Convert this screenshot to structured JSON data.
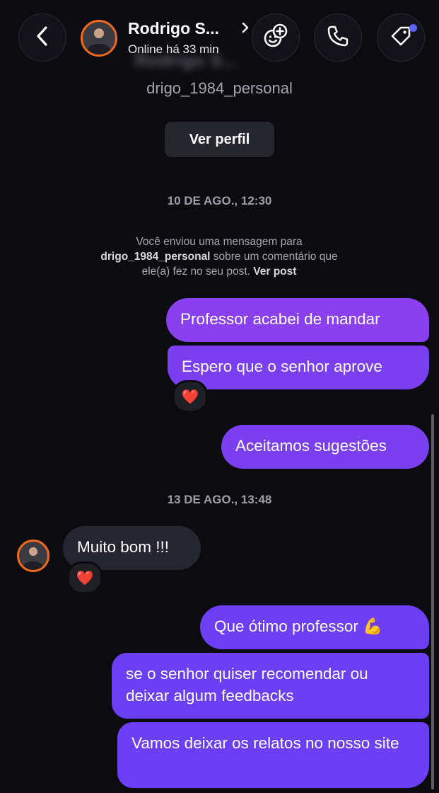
{
  "header": {
    "contact_name": "Rodrigo S...",
    "status": "Online há 33 min",
    "icons": [
      "back-chevron-icon",
      "effects-add-icon",
      "phone-icon",
      "tag-icon"
    ],
    "accent_dot_color": "#5b63ff"
  },
  "profile": {
    "username": "drigo_1984_personal",
    "view_profile_label": "Ver perfil"
  },
  "timestamps": [
    "10 DE AGO., 12:30",
    "13 DE AGO., 13:48"
  ],
  "system_message": {
    "line_a": "Você enviou uma mensagem para",
    "user": "drigo_1984_personal",
    "line_b": " sobre um comentário que",
    "line_c": "ele(a) fez no seu post. ",
    "link": "Ver post"
  },
  "messages": [
    {
      "from": "me",
      "text": "Professor acabei de mandar"
    },
    {
      "from": "me",
      "text": "Espero que o senhor aprove",
      "reaction": "❤️"
    },
    {
      "from": "me",
      "text": "Aceitamos sugestões"
    },
    {
      "from": "them",
      "text": "Muito bom !!!",
      "reaction": "❤️"
    },
    {
      "from": "me",
      "text": "Que ótimo professor 💪"
    },
    {
      "from": "me",
      "text": "se o senhor quiser recomendar ou deixar algum feedbacks"
    },
    {
      "from": "me",
      "text": "Vamos deixar os relatos no nosso site"
    }
  ],
  "colors": {
    "background": "#0b0b10",
    "outgoing_bubble": "#7b3ff2",
    "incoming_bubble": "#262630",
    "avatar_ring": "#f0691e"
  }
}
